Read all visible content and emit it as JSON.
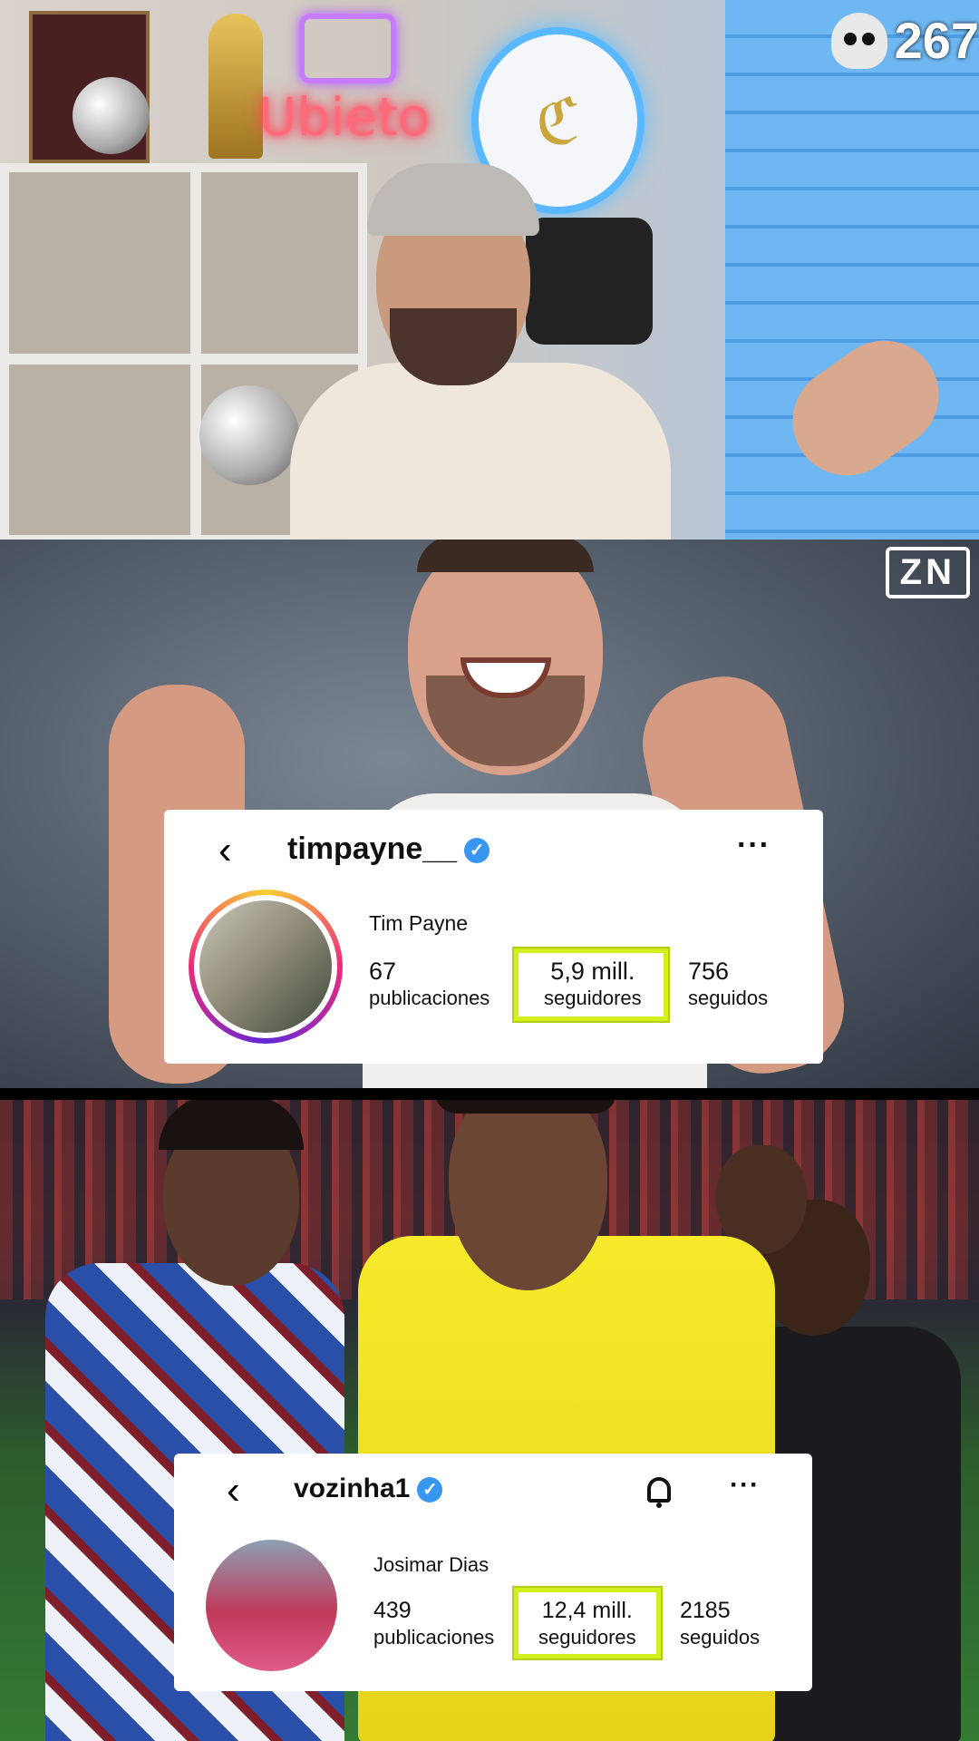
{
  "overlay": {
    "viewer_count": "267",
    "skull_icon": "skull-icon",
    "watermark": "ZN",
    "neon_sign": "Ubieto"
  },
  "profile_1": {
    "back_icon": "chevron-left-icon",
    "username": "timpayne__",
    "verified_icon": "verified-badge-icon",
    "more_label": "···",
    "display_name": "Tim Payne",
    "posts_count": "67",
    "posts_label": "publicaciones",
    "followers_count": "5,9 mill.",
    "followers_label": "seguidores",
    "following_count": "756",
    "following_label": "seguidos",
    "highlight_color": "#d4ef1e"
  },
  "profile_2": {
    "back_icon": "chevron-left-icon",
    "username": "vozinha1",
    "verified_icon": "verified-badge-icon",
    "bell_icon": "bell-icon",
    "more_label": "···",
    "display_name": "Josimar Dias",
    "posts_count": "439",
    "posts_label": "publicaciones",
    "followers_count": "12,4 mill.",
    "followers_label": "seguidores",
    "following_count": "2185",
    "following_label": "seguidos",
    "highlight_color": "#d4ef1e"
  },
  "colors": {
    "verified_blue": "#3797f0",
    "goalkeeper_yellow": "#f2e51c",
    "jersey_blue": "#2a4fa8"
  }
}
